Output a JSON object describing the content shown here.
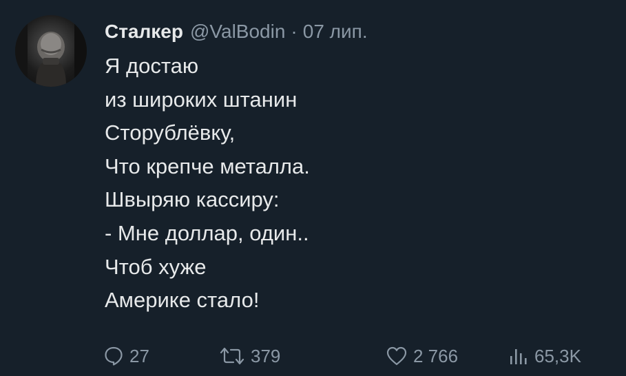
{
  "tweet": {
    "author": {
      "display_name": "Сталкер",
      "handle": "@ValBodin"
    },
    "separator": "·",
    "date": "07 лип.",
    "text_lines": [
      "Я достаю",
      "из широких штанин",
      "Сторублёвку,",
      "Что крепче металла.",
      "Швыряю кассиру:",
      "- Мне доллар, один..",
      "Чтоб хуже",
      "Америке стало!"
    ]
  },
  "actions": {
    "replies": "27",
    "retweets": "379",
    "likes": "2 766",
    "views": "65,3K"
  },
  "icons": {
    "reply": "speech-bubble-icon",
    "retweet": "retweet-arrows-icon",
    "like": "heart-icon",
    "views": "bar-chart-icon"
  },
  "colors": {
    "background": "#16202a",
    "text": "#e7e9ea",
    "secondary": "#8b98a5"
  }
}
